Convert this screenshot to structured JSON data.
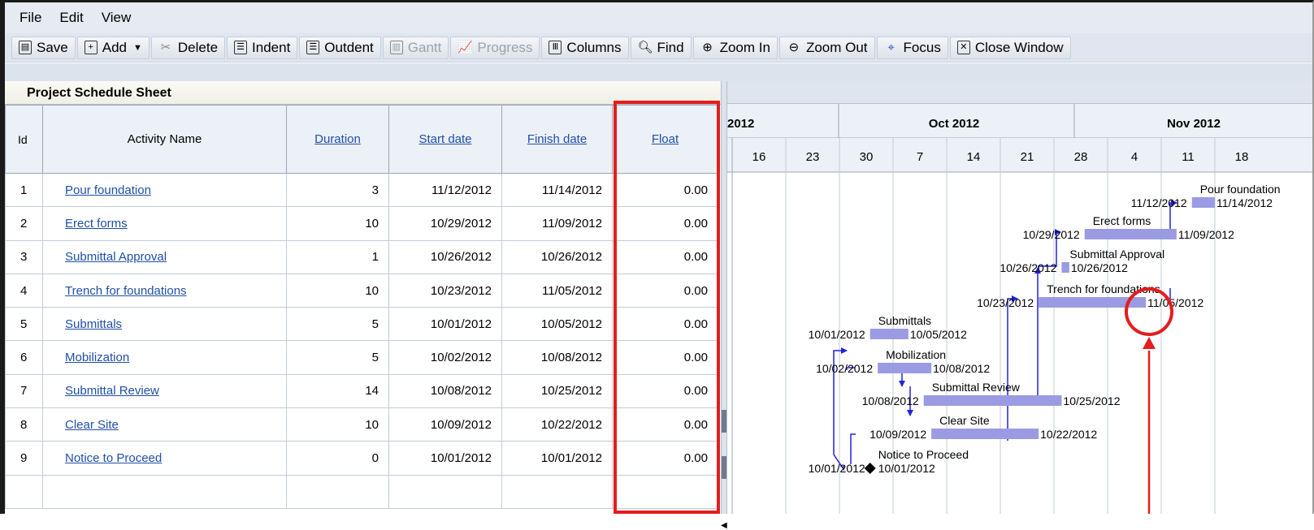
{
  "menu": [
    "File",
    "Edit",
    "View"
  ],
  "toolbar": {
    "save": "Save",
    "add": "Add",
    "delete": "Delete",
    "indent": "Indent",
    "outdent": "Outdent",
    "gantt": "Gantt",
    "progress": "Progress",
    "columns": "Columns",
    "find": "Find",
    "zoom_in": "Zoom In",
    "zoom_out": "Zoom Out",
    "focus": "Focus",
    "close_window": "Close Window"
  },
  "panel_title": "Project Schedule Sheet",
  "columns": {
    "id": "Id",
    "name": "Activity Name",
    "duration": "Duration",
    "start": "Start date",
    "finish": "Finish date",
    "float": "Float"
  },
  "rows": [
    {
      "id": "1",
      "name": "Pour foundation",
      "duration": "3",
      "start": "11/12/2012",
      "finish": "11/14/2012",
      "float": "0.00"
    },
    {
      "id": "2",
      "name": "Erect forms",
      "duration": "10",
      "start": "10/29/2012",
      "finish": "11/09/2012",
      "float": "0.00"
    },
    {
      "id": "3",
      "name": "Submittal Approval",
      "duration": "1",
      "start": "10/26/2012",
      "finish": "10/26/2012",
      "float": "0.00"
    },
    {
      "id": "4",
      "name": "Trench for foundations",
      "duration": "10",
      "start": "10/23/2012",
      "finish": "11/05/2012",
      "float": "0.00"
    },
    {
      "id": "5",
      "name": "Submittals",
      "duration": "5",
      "start": "10/01/2012",
      "finish": "10/05/2012",
      "float": "0.00"
    },
    {
      "id": "6",
      "name": "Mobilization",
      "duration": "5",
      "start": "10/02/2012",
      "finish": "10/08/2012",
      "float": "0.00"
    },
    {
      "id": "7",
      "name": "Submittal Review",
      "duration": "14",
      "start": "10/08/2012",
      "finish": "10/25/2012",
      "float": "0.00"
    },
    {
      "id": "8",
      "name": "Clear Site",
      "duration": "10",
      "start": "10/09/2012",
      "finish": "10/22/2012",
      "float": "0.00"
    },
    {
      "id": "9",
      "name": "Notice to Proceed",
      "duration": "0",
      "start": "10/01/2012",
      "finish": "10/01/2012",
      "float": "0.00"
    }
  ],
  "gantt": {
    "months": [
      "2012",
      "Oct 2012",
      "Nov 2012"
    ],
    "weeks": [
      "16",
      "23",
      "30",
      "7",
      "14",
      "21",
      "28",
      "4",
      "11",
      "18"
    ]
  },
  "colors": {
    "bar": "#9b9be3",
    "highlight": "#e41d1d",
    "link": "#1f4fa6",
    "dependency": "#2222dd"
  }
}
